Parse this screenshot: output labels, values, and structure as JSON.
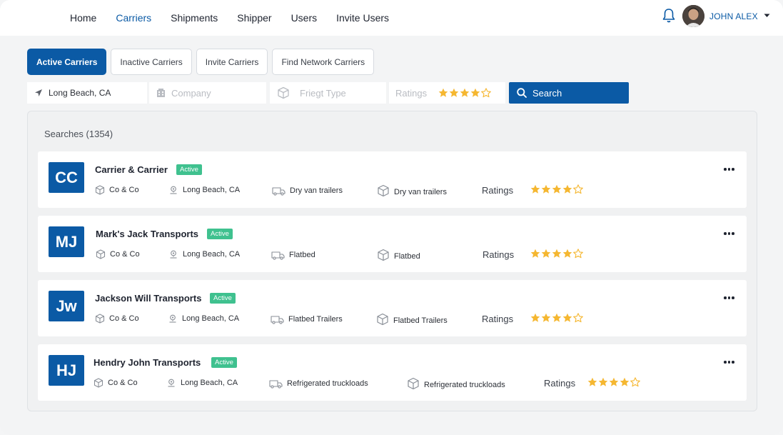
{
  "nav": {
    "items": [
      "Home",
      "Carriers",
      "Shipments",
      "Shipper",
      "Users",
      "Invite Users"
    ],
    "active": "Carriers"
  },
  "user": {
    "name": "JOHN ALEX"
  },
  "tabs": [
    "Active Carriers",
    "Inactive Carriers",
    "Invite Carriers",
    "Find Network Carriers"
  ],
  "filters": {
    "location": "Long Beach, CA",
    "company_placeholder": "Company",
    "freight_placeholder": "Friegt Type",
    "ratings_label": "Ratings",
    "ratings_value": 4,
    "search_label": "Search"
  },
  "results": {
    "count_label": "Searches (1354)",
    "ratings_label": "Ratings",
    "carriers": [
      {
        "initials": "CC",
        "name": "Carrier & Carrier",
        "status": "Active",
        "company": "Co & Co",
        "location": "Long Beach, CA",
        "truck_type": "Dry van trailers",
        "freight_type": "Dry van trailers",
        "rating": 4
      },
      {
        "initials": "MJ",
        "name": "Mark's Jack Transports",
        "status": "Active",
        "company": "Co & Co",
        "location": "Long Beach, CA",
        "truck_type": "Flatbed",
        "freight_type": "Flatbed",
        "rating": 4
      },
      {
        "initials": "Jw",
        "name": "Jackson Will Transports",
        "status": "Active",
        "company": "Co & Co",
        "location": "Long Beach, CA",
        "truck_type": "Flatbed Trailers",
        "freight_type": "Flatbed Trailers",
        "rating": 4
      },
      {
        "initials": "HJ",
        "name": "Hendry John Transports",
        "status": "Active",
        "company": "Co & Co",
        "location": "Long Beach, CA",
        "truck_type": "Refrigerated truckloads",
        "freight_type": "Refrigerated truckloads",
        "rating": 4
      }
    ]
  },
  "colors": {
    "primary": "#0b5aa5",
    "active_badge": "#3fc18f",
    "star": "#f5b731"
  }
}
